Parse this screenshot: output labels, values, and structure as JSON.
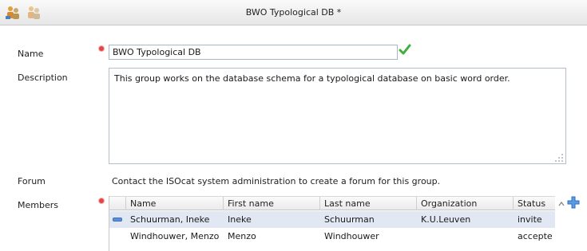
{
  "window": {
    "title": "BWO Typological DB *"
  },
  "toolbar": {
    "icons": [
      "group-edit-icon",
      "group-edit-disabled-icon"
    ]
  },
  "form": {
    "name_label": "Name",
    "name_value": "BWO Typological DB",
    "description_label": "Description",
    "description_value": "This group works on the database schema for a typological database on basic word order.",
    "forum_label": "Forum",
    "forum_text": "Contact the ISOcat system administration to create a forum for this group.",
    "members_label": "Members"
  },
  "members": {
    "columns": [
      "Name",
      "First name",
      "Last name",
      "Organization",
      "Status"
    ],
    "rows": [
      {
        "name": "Schuurman, Ineke",
        "first": "Ineke",
        "last": "Schuurman",
        "org": "K.U.Leuven",
        "status": "invite",
        "selected": true
      },
      {
        "name": "Windhouwer, Menzo",
        "first": "Menzo",
        "last": "Windhouwer",
        "org": "",
        "status": "accepte",
        "selected": false
      }
    ]
  },
  "colors": {
    "required": "#e54545",
    "valid": "#3fae3a",
    "selection": "#e1e8f3",
    "accent": "#3a7fd5"
  }
}
